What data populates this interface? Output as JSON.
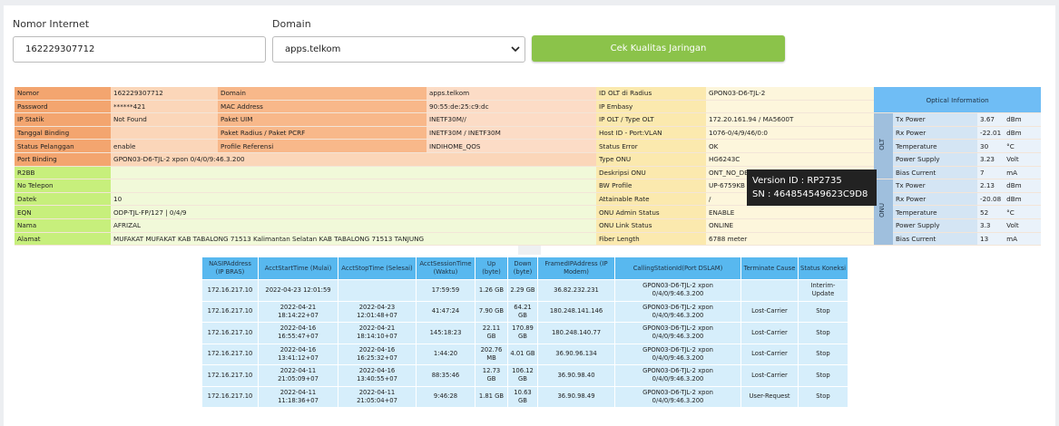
{
  "form": {
    "nomor_label": "Nomor Internet",
    "nomor_value": "162229307712",
    "domain_label": "Domain",
    "domain_value": "apps.telkom",
    "button_label": "Cek Kualitas Jaringan"
  },
  "info": {
    "rows": [
      {
        "l1": "Nomor",
        "v1": "162229307712",
        "l2": "Domain",
        "v2": "apps.telkom",
        "l3": "ID OLT di Radius",
        "v3": "GPON03-D6-TJL-2"
      },
      {
        "l1": "Password",
        "v1": "******421",
        "l2": "MAC Address",
        "v2": "90:55:de:25:c9:dc",
        "l3": "IP Embasy",
        "v3": ""
      },
      {
        "l1": "IP Statik",
        "v1": "Not Found",
        "l2": "Paket UIM",
        "v2": "INETF30M//",
        "l3": "IP OLT / Type OLT",
        "v3": "172.20.161.94 / MA5600T"
      },
      {
        "l1": "Tanggal Binding",
        "v1": "",
        "l2": "Paket Radius / Paket PCRF",
        "v2": "INETF30M / INETF30M",
        "l3": "Host ID - Port:VLAN",
        "v3": "1076-0/4/9/46/0:0"
      },
      {
        "l1": "Status Pelanggan",
        "v1": "enable",
        "l2": "Profile Referensi",
        "v2": "INDIHOME_QOS",
        "l3": "Status Error",
        "v3": "OK"
      },
      {
        "l1": "Port Binding",
        "v1": "GPON03-D6-TJL-2 xpon 0/4/0/9:46.3.200",
        "l3": "Type ONU",
        "v3": "HG6243C"
      },
      {
        "l1": "R2BB",
        "v1": "",
        "l3": "Deskripsi ONU",
        "v3": "ONT_NO_DESCRIPTION"
      },
      {
        "l1": "No Telepon",
        "v1": "",
        "l3": "BW Profile",
        "v3": "UP-6759KB"
      },
      {
        "l1": "Datek",
        "v1": "10",
        "l3": "Attainable Rate",
        "v3": "/"
      },
      {
        "l1": "EQN",
        "v1": "ODP-TJL-FP/127 | 0/4/9",
        "l3": "ONU Admin Status",
        "v3": "ENABLE"
      },
      {
        "l1": "Nama",
        "v1": "AFRIZAL",
        "l3": "ONU Link Status",
        "v3": "ONLINE"
      },
      {
        "l1": "Alamat",
        "v1": "MUFAKAT MUFAKAT KAB TABALONG 71513 Kalimantan Selatan KAB TABALONG 71513 TANJUNG",
        "l3": "Fiber Length",
        "v3": "6788 meter"
      }
    ]
  },
  "optical": {
    "title": "Optical Information",
    "olt_label": "OLT",
    "onu_label": "ONU",
    "olt": [
      {
        "name": "Tx Power",
        "value": "3.67",
        "unit": "dBm"
      },
      {
        "name": "Rx Power",
        "value": "-22.01",
        "unit": "dBm"
      },
      {
        "name": "Temperature",
        "value": "30",
        "unit": "°C"
      },
      {
        "name": "Power Supply",
        "value": "3.23",
        "unit": "Volt"
      },
      {
        "name": "Bias Current",
        "value": "7",
        "unit": "mA"
      }
    ],
    "onu": [
      {
        "name": "Tx Power",
        "value": "2.13",
        "unit": "dBm"
      },
      {
        "name": "Rx Power",
        "value": "-20.08",
        "unit": "dBm"
      },
      {
        "name": "Temperature",
        "value": "52",
        "unit": "°C"
      },
      {
        "name": "Power Supply",
        "value": "3.3",
        "unit": "Volt"
      },
      {
        "name": "Bias Current",
        "value": "13",
        "unit": "mA"
      }
    ]
  },
  "tooltip": {
    "line1": "Version ID : RP2735",
    "line2": "SN : 464854549623C9D8"
  },
  "sessions": {
    "headers": [
      "NASIPAddress (IP BRAS)",
      "AcctStartTime (Mulai)",
      "AcctStopTime (Selesai)",
      "AcctSessionTime (Waktu)",
      "Up (byte)",
      "Down (byte)",
      "FramedIPAddress (IP Modem)",
      "CallingStationId(Port DSLAM)",
      "Terminate Cause",
      "Status Koneksi"
    ],
    "rows": [
      [
        "172.16.217.10",
        "2022-04-23 12:01:59",
        "",
        "17:59:59",
        "1.26 GB",
        "2.29 GB",
        "36.82.232.231",
        "GPON03-D6-TJL-2 xpon 0/4/0/9:46.3.200",
        "",
        "Interim-Update"
      ],
      [
        "172.16.217.10",
        "2022-04-21 18:14:22+07",
        "2022-04-23 12:01:48+07",
        "41:47:24",
        "7.90 GB",
        "64.21 GB",
        "180.248.141.146",
        "GPON03-D6-TJL-2 xpon 0/4/0/9:46.3.200",
        "Lost-Carrier",
        "Stop"
      ],
      [
        "172.16.217.10",
        "2022-04-16 16:55:47+07",
        "2022-04-21 18:14:10+07",
        "145:18:23",
        "22.11 GB",
        "170.89 GB",
        "180.248.140.77",
        "GPON03-D6-TJL-2 xpon 0/4/0/9:46.3.200",
        "Lost-Carrier",
        "Stop"
      ],
      [
        "172.16.217.10",
        "2022-04-16 13:41:12+07",
        "2022-04-16 16:25:32+07",
        "1:44:20",
        "202.76 MB",
        "4.01 GB",
        "36.90.96.134",
        "GPON03-D6-TJL-2 xpon 0/4/0/9:46.3.200",
        "Lost-Carrier",
        "Stop"
      ],
      [
        "172.16.217.10",
        "2022-04-11 21:05:09+07",
        "2022-04-16 13:40:55+07",
        "88:35:46",
        "12.73 GB",
        "106.12 GB",
        "36.90.98.40",
        "GPON03-D6-TJL-2 xpon 0/4/0/9:46.3.200",
        "Lost-Carrier",
        "Stop"
      ],
      [
        "172.16.217.10",
        "2022-04-11 11:18:36+07",
        "2022-04-11 21:05:04+07",
        "9:46:28",
        "1.81 GB",
        "10.63 GB",
        "36.90.98.49",
        "GPON03-D6-TJL-2 xpon 0/4/0/9:46.3.200",
        "User-Request",
        "Stop"
      ]
    ]
  }
}
